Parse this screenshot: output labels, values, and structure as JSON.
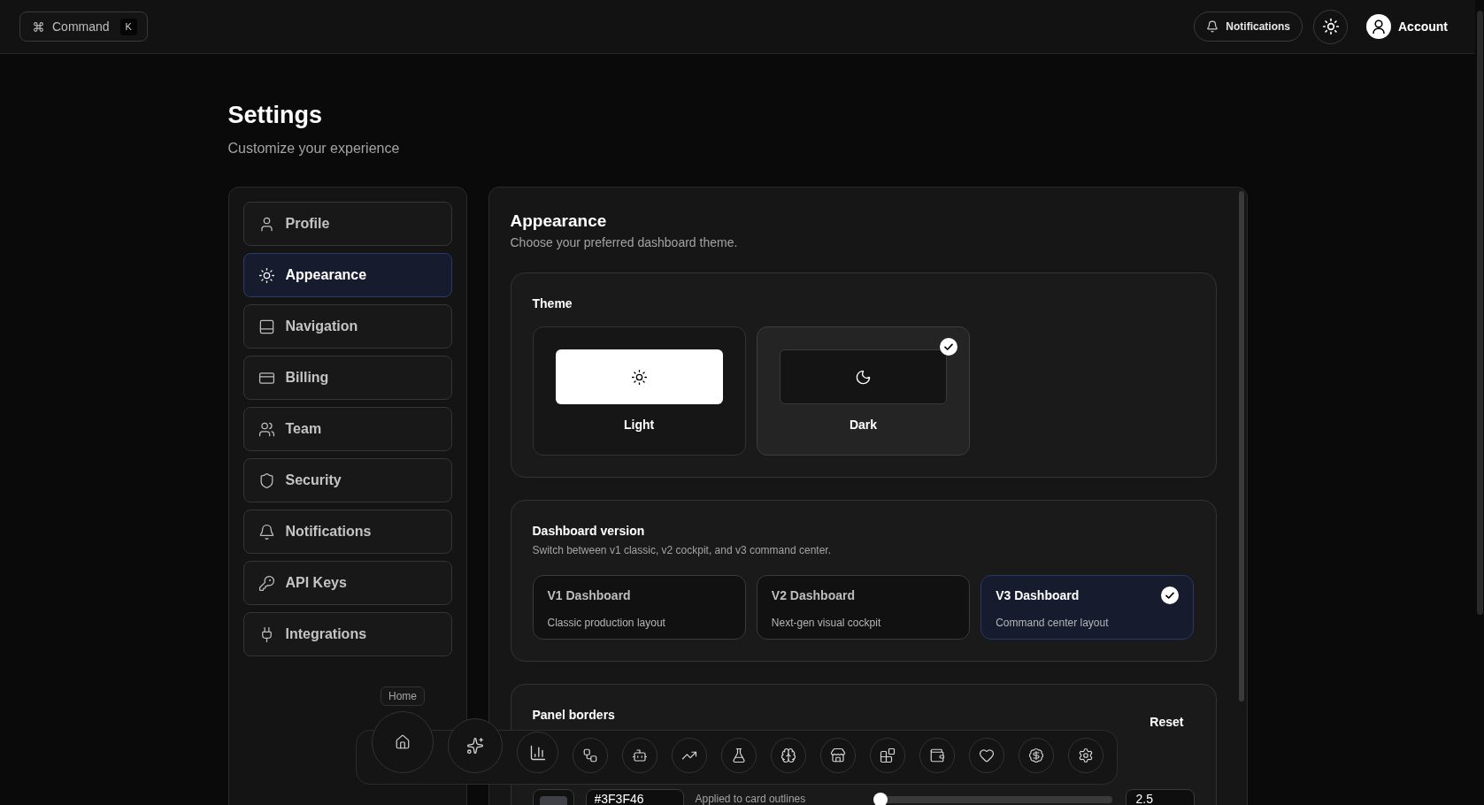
{
  "top_bar": {
    "command_button": {
      "label": "Command",
      "shortcut": "K"
    },
    "notifications_button": "Notifications",
    "account_label": "Account"
  },
  "header": {
    "title": "Settings",
    "subtitle": "Customize your experience"
  },
  "sidebar": {
    "items": [
      {
        "label": "Profile",
        "selected": false
      },
      {
        "label": "Appearance",
        "selected": true
      },
      {
        "label": "Navigation",
        "selected": false
      },
      {
        "label": "Billing",
        "selected": false
      },
      {
        "label": "Team",
        "selected": false
      },
      {
        "label": "Security",
        "selected": false
      },
      {
        "label": "Notifications",
        "selected": false
      },
      {
        "label": "API Keys",
        "selected": false
      },
      {
        "label": "Integrations",
        "selected": false
      }
    ]
  },
  "appearance": {
    "title": "Appearance",
    "subtitle": "Choose your preferred dashboard theme."
  },
  "theme": {
    "title": "Theme",
    "options": [
      {
        "kind": "light",
        "label": "Light",
        "selected": false
      },
      {
        "kind": "dark",
        "label": "Dark",
        "selected": true
      }
    ]
  },
  "dashboard_version": {
    "title": "Dashboard version",
    "subtitle": "Switch between v1 classic, v2 cockpit, and v3 command center.",
    "options": [
      {
        "title": "V1 Dashboard",
        "description": "Classic production layout",
        "selected": false
      },
      {
        "title": "V2 Dashboard",
        "description": "Next-gen visual cockpit",
        "selected": false
      },
      {
        "title": "V3 Dashboard",
        "description": "Command center layout",
        "selected": true
      }
    ]
  },
  "panel_borders": {
    "title": "Panel borders",
    "reset_button": "Reset",
    "color_value": "#3F3F46",
    "hint": "Applied to card outlines",
    "thickness": {
      "level": 0.03,
      "value": "2.5"
    }
  },
  "dock": {
    "tooltip": "Home"
  }
}
